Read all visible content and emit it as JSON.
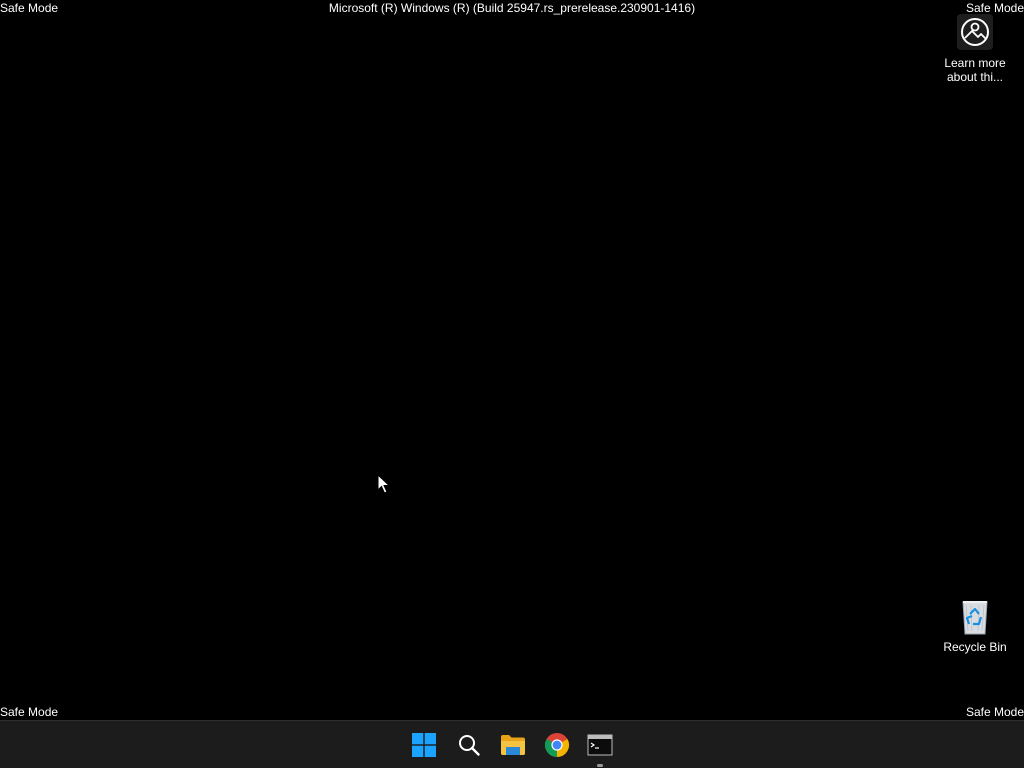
{
  "desktop": {
    "watermark": {
      "top_left": "Safe Mode",
      "top_right": "Safe Mode",
      "bottom_left": "Safe Mode",
      "bottom_right": "Safe Mode",
      "build": "Microsoft (R) Windows (R) (Build 25947.rs_prerelease.230901-1416)"
    },
    "icons": {
      "learn_more": {
        "label": "Learn more about thi...",
        "icon": "learn-more-icon"
      },
      "recycle_bin": {
        "label": "Recycle Bin",
        "icon": "recycle-bin-icon"
      }
    }
  },
  "taskbar": {
    "items": [
      {
        "name": "Start",
        "icon": "windows-logo-icon"
      },
      {
        "name": "Search",
        "icon": "search-icon"
      },
      {
        "name": "File Explorer",
        "icon": "folder-icon"
      },
      {
        "name": "Google Chrome",
        "icon": "chrome-icon"
      },
      {
        "name": "Command Prompt",
        "icon": "terminal-icon",
        "running": true
      }
    ]
  },
  "colors": {
    "desktop_background": "#000000",
    "taskbar_background": "#1c1c1c",
    "windows_blue": "#1aa3ff",
    "folder_yellow": "#f5c342"
  }
}
